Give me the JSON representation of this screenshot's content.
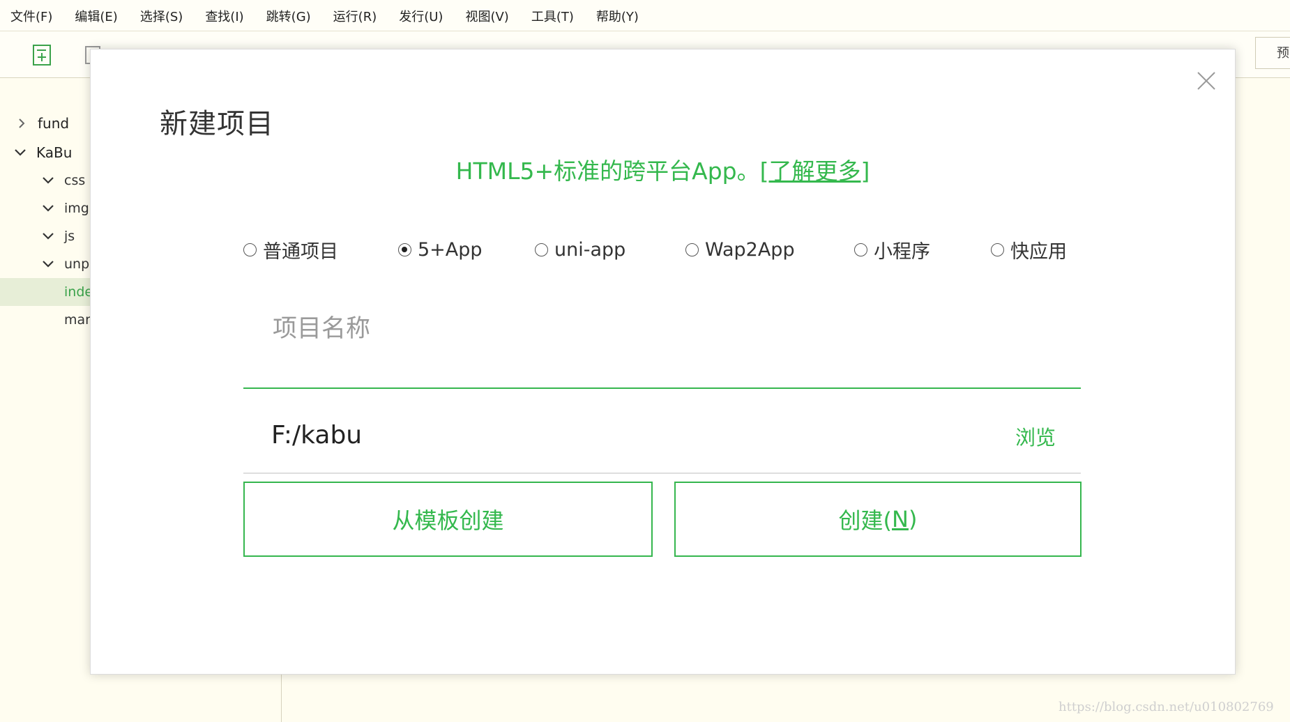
{
  "menu": [
    "文件(F)",
    "编辑(E)",
    "选择(S)",
    "查找(I)",
    "跳转(G)",
    "运行(R)",
    "发行(U)",
    "视图(V)",
    "工具(T)",
    "帮助(Y)"
  ],
  "toolbar": {
    "preview_label": "预"
  },
  "sidebar": {
    "items": [
      {
        "label": "fund",
        "expanded": false,
        "level": 0
      },
      {
        "label": "KaBu",
        "expanded": true,
        "level": 0
      },
      {
        "label": "css",
        "expanded": true,
        "level": 1
      },
      {
        "label": "img",
        "expanded": true,
        "level": 1
      },
      {
        "label": "js",
        "expanded": true,
        "level": 1
      },
      {
        "label": "unp",
        "expanded": true,
        "level": 1
      },
      {
        "label": "inde",
        "level": 1,
        "selected": true
      },
      {
        "label": "man",
        "level": 1
      }
    ]
  },
  "dialog": {
    "title": "新建项目",
    "subtitle": "HTML5+标准的跨平台App。",
    "subtitle_link": "[了解更多]",
    "project_types": [
      {
        "label": "普通项目",
        "selected": false
      },
      {
        "label": "5+App",
        "selected": true
      },
      {
        "label": "uni-app",
        "selected": false
      },
      {
        "label": "Wap2App",
        "selected": false
      },
      {
        "label": "小程序",
        "selected": false
      },
      {
        "label": "快应用",
        "selected": false
      }
    ],
    "name_placeholder": "项目名称",
    "name_value": "",
    "path_value": "F:/kabu",
    "browse_label": "浏览",
    "template_button": "从模板创建",
    "create_button_prefix": "创建(",
    "create_button_key": "N",
    "create_button_suffix": ")"
  },
  "watermark": "https://blog.csdn.net/u010802769",
  "colors": {
    "accent": "#34b84d",
    "background": "#fffdf0",
    "selected_row": "#e7eed7"
  }
}
